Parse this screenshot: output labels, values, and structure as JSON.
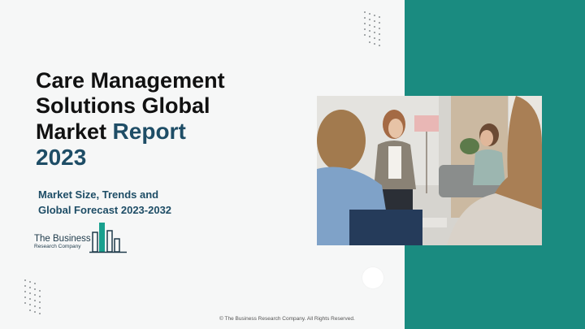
{
  "title": {
    "line1": "Care Management",
    "line2": "Solutions Global",
    "line3_main": "Market ",
    "line3_accent": "Report",
    "line4": "2023"
  },
  "subtitle": {
    "line1": "Market Size, Trends and",
    "line2": "Global Forecast 2023-2032"
  },
  "logo": {
    "line1": "The Business",
    "line2": "Research Company"
  },
  "footer": "© The Business Research Company. All Rights Reserved.",
  "colors": {
    "teal_panel": "#1a8b80",
    "title_text": "#111111",
    "accent_text": "#1e4d66",
    "logo_teal": "#19a08e"
  },
  "icons": [
    "dot-grid-pattern",
    "logo-building-bars-icon"
  ]
}
